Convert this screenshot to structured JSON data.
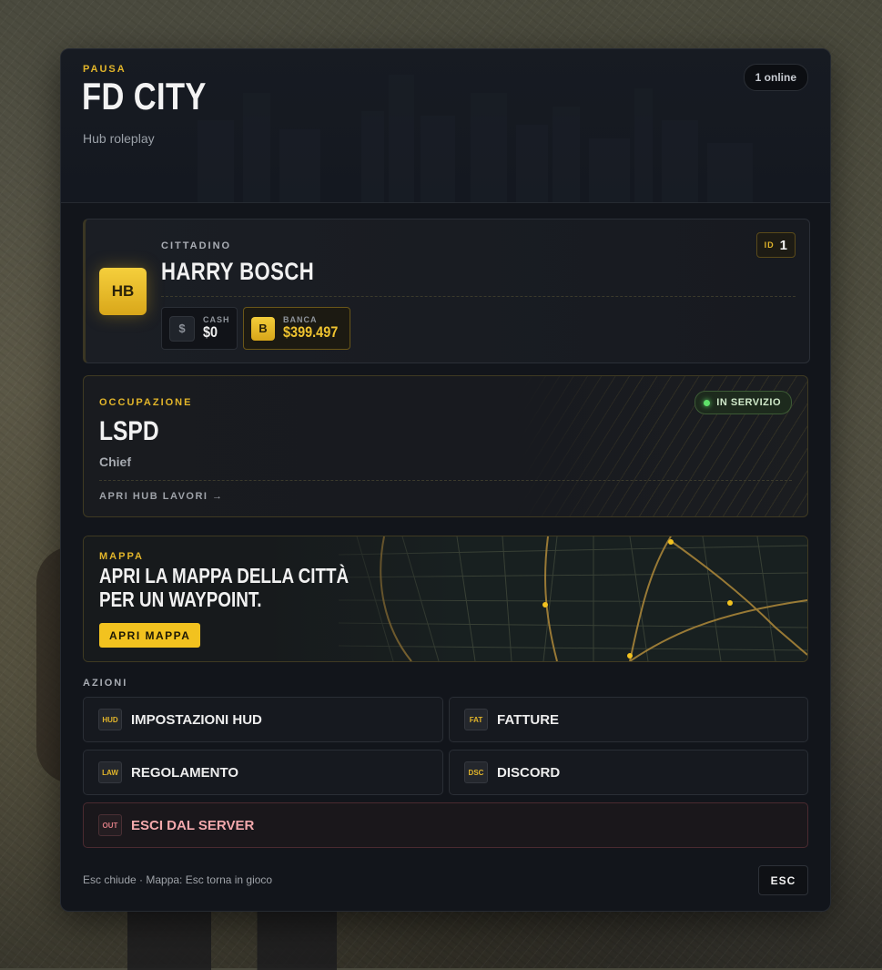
{
  "header": {
    "kicker": "PAUSA",
    "title": "FD CITY",
    "subtitle": "Hub roleplay",
    "online": "1 online"
  },
  "character": {
    "kicker": "CITTADINO",
    "initials": "HB",
    "name": "HARRY BOSCH",
    "id_label": "ID",
    "id_value": "1",
    "cash": {
      "icon": "$",
      "label": "CASH",
      "value": "$0"
    },
    "bank": {
      "icon": "B",
      "label": "BANCA",
      "value": "$399.497"
    }
  },
  "job": {
    "kicker": "OCCUPAZIONE",
    "name": "LSPD",
    "grade": "Chief",
    "status": "IN SERVIZIO",
    "status_color": "#5fe16a",
    "link": "APRI HUB LAVORI →"
  },
  "map": {
    "kicker": "MAPPA",
    "text": "APRI LA MAPPA DELLA CITTÀ PER UN WAYPOINT.",
    "button": "APRI MAPPA"
  },
  "actions": {
    "label": "AZIONI",
    "items": [
      {
        "tag": "HUD",
        "label": "IMPOSTAZIONI HUD"
      },
      {
        "tag": "FAT",
        "label": "FATTURE"
      },
      {
        "tag": "LAW",
        "label": "REGOLAMENTO"
      },
      {
        "tag": "DSC",
        "label": "DISCORD"
      }
    ],
    "exit": {
      "tag": "OUT",
      "label": "ESCI DAL SERVER"
    }
  },
  "footer": {
    "hint": "Esc chiude · Mappa: Esc torna in gioco",
    "esc_label": "ESC"
  },
  "colors": {
    "accent": "#f2c21f",
    "panel": "#12151b",
    "danger": "#f3a9ac"
  }
}
